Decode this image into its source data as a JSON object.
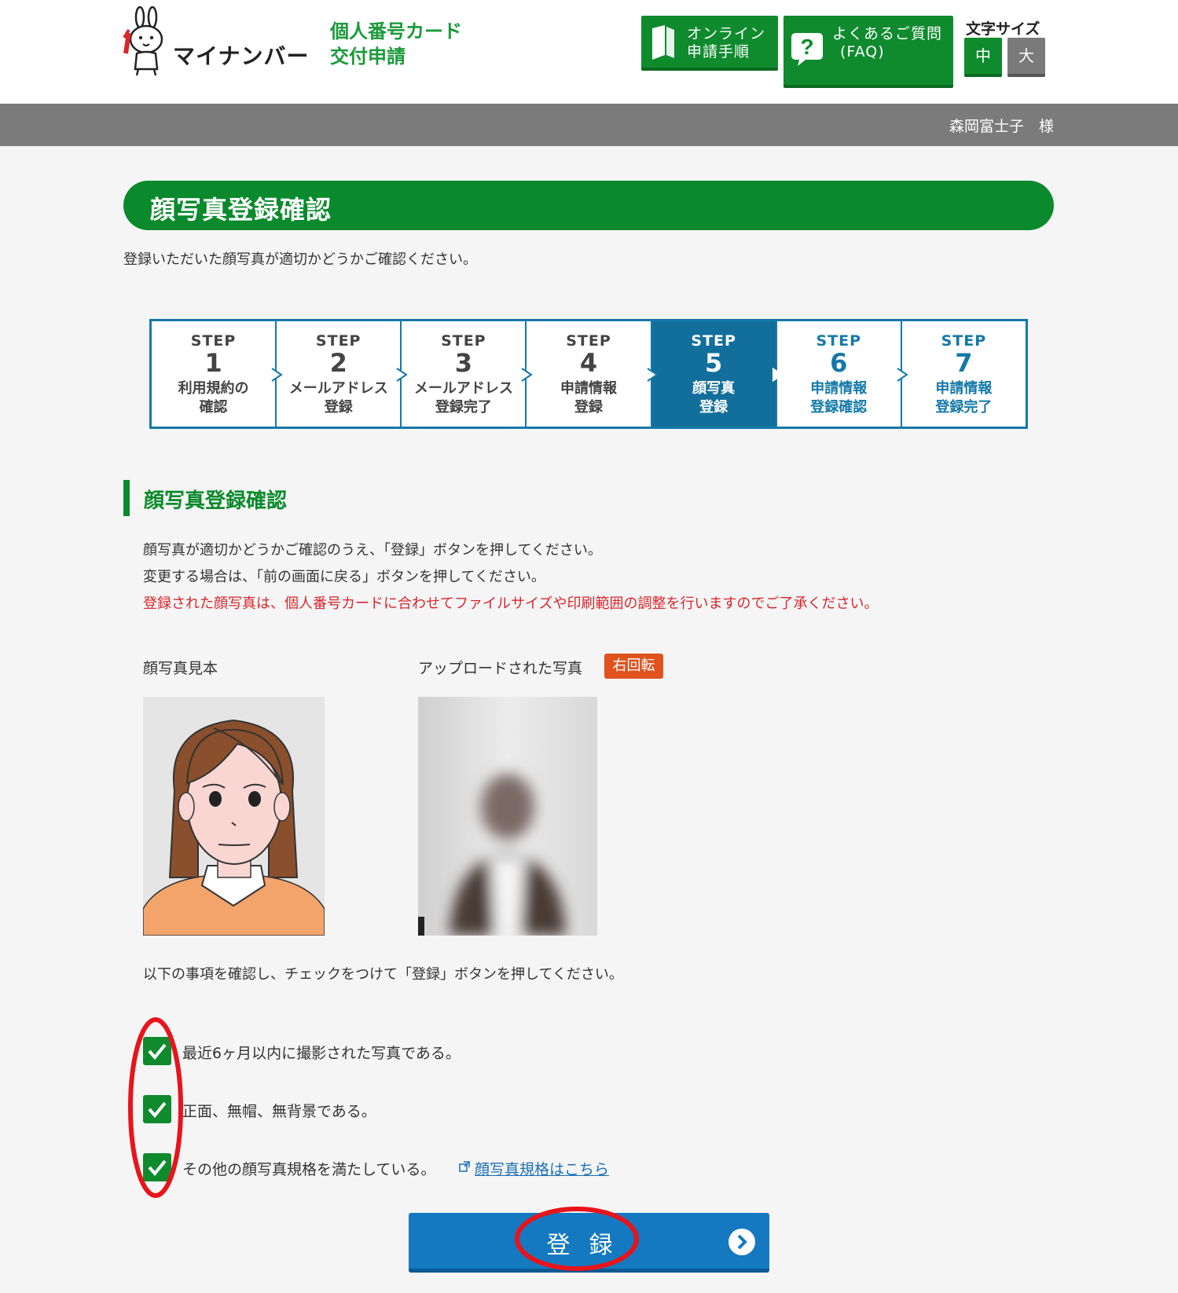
{
  "header": {
    "logo_text": "マイナンバー",
    "service_line1": "個人番号カード",
    "service_line2": "交付申請",
    "online_btn_line1": "オンライン",
    "online_btn_line2": "申請手順",
    "faq_btn_line1": "よくあるご質問",
    "faq_btn_line2": "(FAQ)",
    "font_size_label": "文字サイズ",
    "font_size_medium": "中",
    "font_size_large": "大",
    "user_name": "森岡富士子　様"
  },
  "page": {
    "title": "顔写真登録確認",
    "intro": "登録いただいた顔写真が適切かどうかご確認ください。"
  },
  "steps": [
    {
      "step": "STEP",
      "num": "1",
      "label": "利用規約の\n確認",
      "state": "done"
    },
    {
      "step": "STEP",
      "num": "2",
      "label": "メールアドレス\n登録",
      "state": "done"
    },
    {
      "step": "STEP",
      "num": "3",
      "label": "メールアドレス\n登録完了",
      "state": "done"
    },
    {
      "step": "STEP",
      "num": "4",
      "label": "申請情報\n登録",
      "state": "done"
    },
    {
      "step": "STEP",
      "num": "5",
      "label": "顔写真\n登録",
      "state": "active"
    },
    {
      "step": "STEP",
      "num": "6",
      "label": "申請情報\n登録確認",
      "state": "todo"
    },
    {
      "step": "STEP",
      "num": "7",
      "label": "申請情報\n登録完了",
      "state": "todo"
    }
  ],
  "section": {
    "heading": "顔写真登録確認",
    "desc1": "顔写真が適切かどうかご確認のうえ、「登録」ボタンを押してください。",
    "desc2": "変更する場合は、「前の画面に戻る」ボタンを押してください。",
    "warning": "登録された顔写真は、個人番号カードに合わせてファイルサイズや印刷範囲の調整を行いますのでご了承ください。",
    "sample_label": "顔写真見本",
    "uploaded_label": "アップロードされた写真",
    "rotate_label": "右回転",
    "checklist_intro": "以下の事項を確認し、チェックをつけて「登録」ボタンを押してください。",
    "checks": [
      {
        "label": "最近6ヶ月以内に撮影された写真である。",
        "checked": true
      },
      {
        "label": "正面、無帽、無背景である。",
        "checked": true
      },
      {
        "label": "その他の顔写真規格を満たしている。",
        "checked": true
      }
    ],
    "spec_link": "顔写真規格はこちら",
    "register_label": "登録"
  },
  "colors": {
    "brand_green": "#0a8a2c",
    "step_blue": "#1479a8",
    "register_blue": "#1479c0",
    "warning_red": "#d8262c",
    "annotation_red": "#e8141c"
  }
}
